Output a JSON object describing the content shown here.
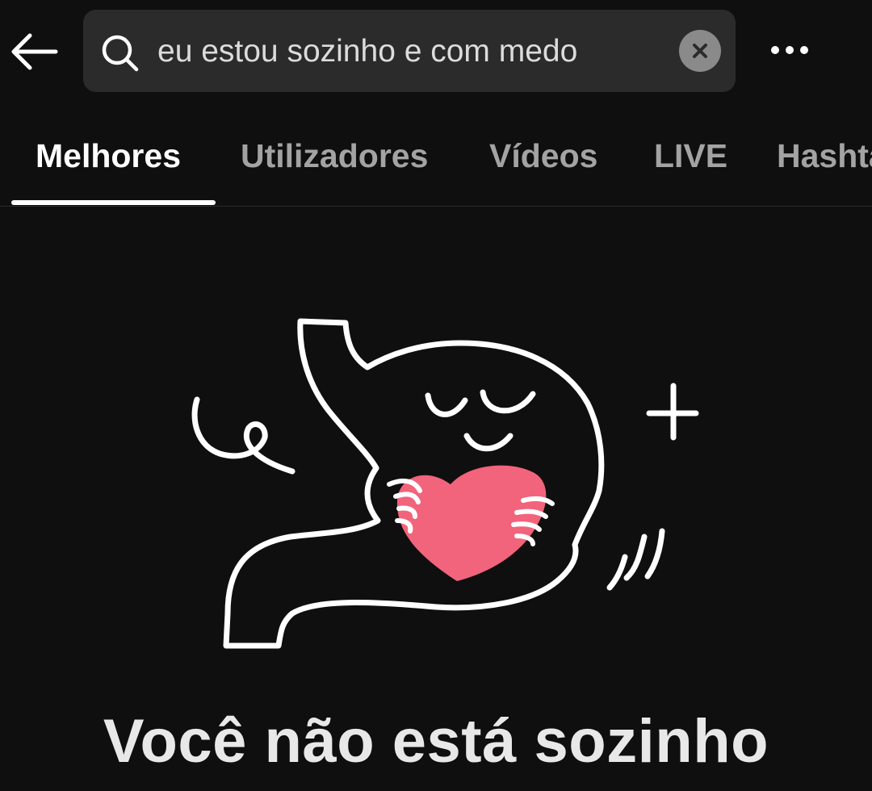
{
  "search": {
    "query": "eu estou sozinho e com medo"
  },
  "icons": {
    "back": "arrow-left-icon",
    "search": "search-icon",
    "clear": "close-icon",
    "more": "more-horizontal-icon"
  },
  "tabs": [
    {
      "label": "Melhores",
      "active": true
    },
    {
      "label": "Utilizadores",
      "active": false
    },
    {
      "label": "Vídeos",
      "active": false
    },
    {
      "label": "LIVE",
      "active": false
    },
    {
      "label": "Hashtags",
      "active": false
    }
  ],
  "message": {
    "headline": "Você não está sozinho"
  },
  "colors": {
    "background": "#0f0f0f",
    "search_bg": "#2b2b2b",
    "heart": "#f2637c",
    "line": "#ffffff"
  }
}
